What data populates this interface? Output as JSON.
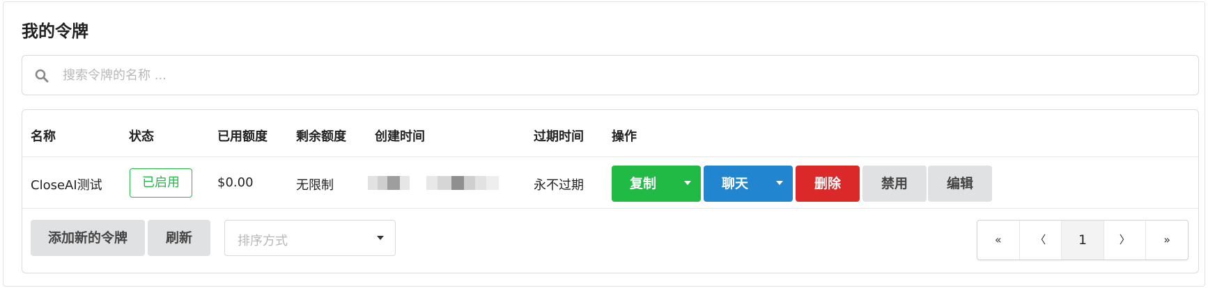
{
  "page": {
    "title": "我的令牌"
  },
  "search": {
    "placeholder": "搜索令牌的名称 ...",
    "value": ""
  },
  "table": {
    "headers": [
      "名称",
      "状态",
      "已用额度",
      "剩余额度",
      "创建时间",
      "过期时间",
      "操作"
    ],
    "rows": [
      {
        "name": "CloseAI测试",
        "status": "已启用",
        "used_quota": "$0.00",
        "remaining_quota": "无限制",
        "expire_time": "永不过期"
      }
    ]
  },
  "actions": {
    "copy": "复制",
    "chat": "聊天",
    "delete": "删除",
    "disable": "禁用",
    "edit": "编辑"
  },
  "footer": {
    "add_token": "添加新的令牌",
    "refresh": "刷新",
    "sort_placeholder": "排序方式"
  },
  "pagination": {
    "first": "«",
    "prev": "〈",
    "current": "1",
    "next": "〉",
    "last": "»"
  },
  "colors": {
    "green": "#21ba45",
    "blue": "#2185d0",
    "red": "#db2828",
    "grey": "#e0e1e2"
  }
}
